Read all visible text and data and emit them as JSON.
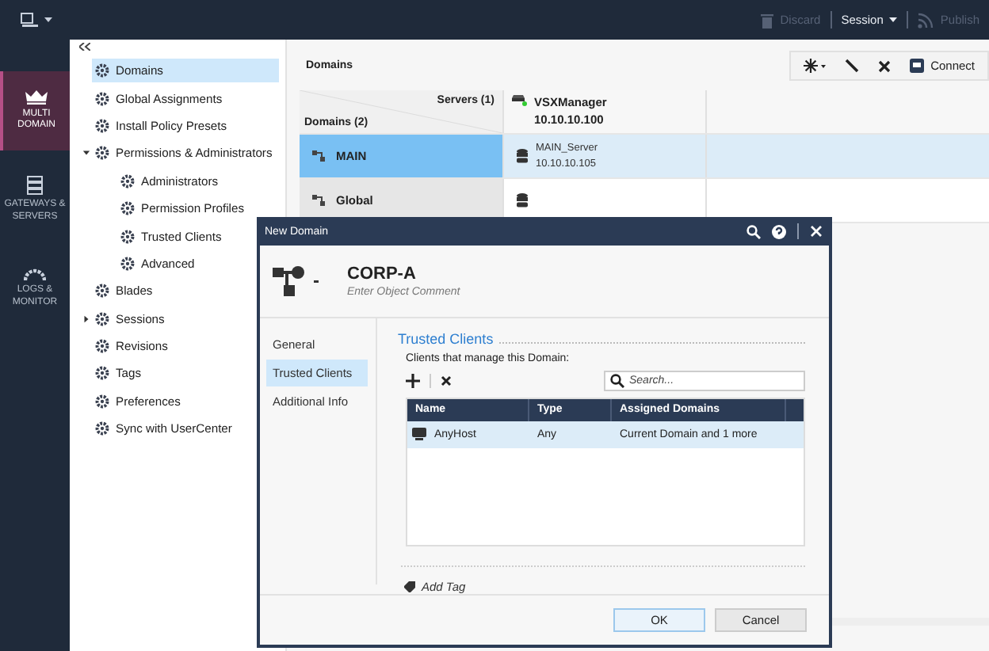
{
  "top_bar": {
    "actions": [
      {
        "kind": "discard",
        "label": "Discard",
        "disabled": true
      },
      {
        "kind": "session",
        "label": "Session",
        "disabled": false
      },
      {
        "kind": "publish",
        "label": "Publish",
        "disabled": true
      }
    ]
  },
  "nav": [
    {
      "label": "MULTI DOMAIN",
      "selected": true
    },
    {
      "label": "GATEWAYS & SERVERS",
      "selected": false
    },
    {
      "label": "LOGS & MONITOR",
      "selected": false
    }
  ],
  "tree": [
    {
      "label": "Domains",
      "selected": true
    },
    {
      "label": "Global Assignments",
      "selected": false
    },
    {
      "label": "Install Policy Presets",
      "selected": false
    },
    {
      "label": "Permissions & Administrators",
      "selected": false,
      "expanded": true,
      "children": [
        {
          "label": "Administrators",
          "selected": false
        },
        {
          "label": "Permission Profiles",
          "selected": false
        },
        {
          "label": "Trusted Clients",
          "selected": false
        },
        {
          "label": "Advanced",
          "selected": false
        }
      ]
    },
    {
      "label": "Blades",
      "selected": false
    },
    {
      "label": "Sessions",
      "selected": false,
      "expanded": false
    },
    {
      "label": "Revisions",
      "selected": false
    },
    {
      "label": "Tags",
      "selected": false
    },
    {
      "label": "Preferences",
      "selected": false
    },
    {
      "label": "Sync with UserCenter",
      "selected": false
    }
  ],
  "main": {
    "title": "Domains",
    "toolbar": {
      "connect_label": "Connect"
    },
    "grid": {
      "servers_header": "Servers (1)",
      "domains_header": "Domains (2)",
      "columns": [
        {
          "name": "VSXManager",
          "ip": "10.10.10.100"
        }
      ],
      "rows": [
        {
          "name": "MAIN",
          "selected": true,
          "cells": [
            {
              "name": "MAIN_Server",
              "ip": "10.10.10.105"
            }
          ]
        },
        {
          "name": "Global",
          "selected": false,
          "cells": [
            {}
          ]
        }
      ]
    }
  },
  "dialog": {
    "title": "New Domain",
    "object_name": "CORP-A",
    "comment_placeholder": "Enter Object Comment",
    "sections": [
      {
        "label": "General",
        "selected": false
      },
      {
        "label": "Trusted Clients",
        "selected": true
      },
      {
        "label": "Additional Info",
        "selected": false
      }
    ],
    "section_title": "Trusted Clients",
    "subtitle": "Clients that manage this Domain:",
    "search_placeholder": "Search...",
    "table": {
      "columns": [
        "Name",
        "Type",
        "Assigned Domains"
      ],
      "rows": [
        {
          "name": "AnyHost",
          "type": "Any",
          "assigned": "Current Domain and 1 more",
          "selected": true
        }
      ]
    },
    "add_tag": "Add Tag",
    "buttons": [
      {
        "label": "OK",
        "kind": "primary"
      },
      {
        "label": "Cancel",
        "kind": "secondary"
      }
    ]
  }
}
